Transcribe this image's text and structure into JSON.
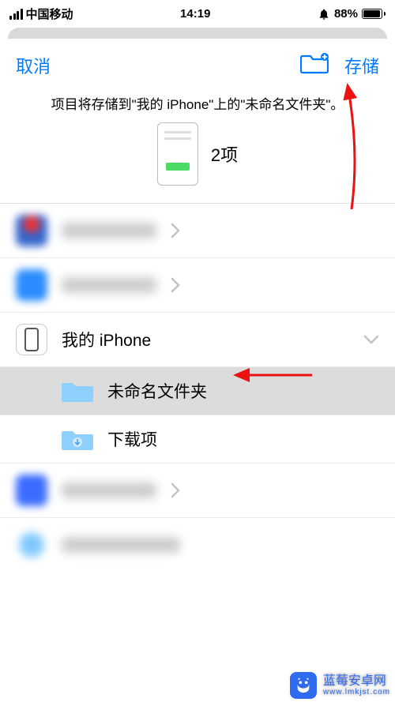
{
  "status": {
    "carrier": "中国移动",
    "time": "14:19",
    "battery_pct": "88%"
  },
  "nav": {
    "cancel": "取消",
    "save": "存储"
  },
  "sheet": {
    "description": "项目将存储到\"我的 iPhone\"上的\"未命名文件夹\"。",
    "item_count": "2项"
  },
  "locations": {
    "blurred_1": "████",
    "blurred_2": "████",
    "my_iphone": "我的 iPhone",
    "folders": {
      "unnamed": "未命名文件夹",
      "downloads": "下载项"
    },
    "blurred_3": "████",
    "blurred_4": "████"
  },
  "watermark": {
    "title": "蓝莓安卓网",
    "url": "www.lmkjst.com"
  },
  "colors": {
    "accent": "#007aff",
    "folder": "#8fd0ff",
    "arrow": "#e11"
  }
}
